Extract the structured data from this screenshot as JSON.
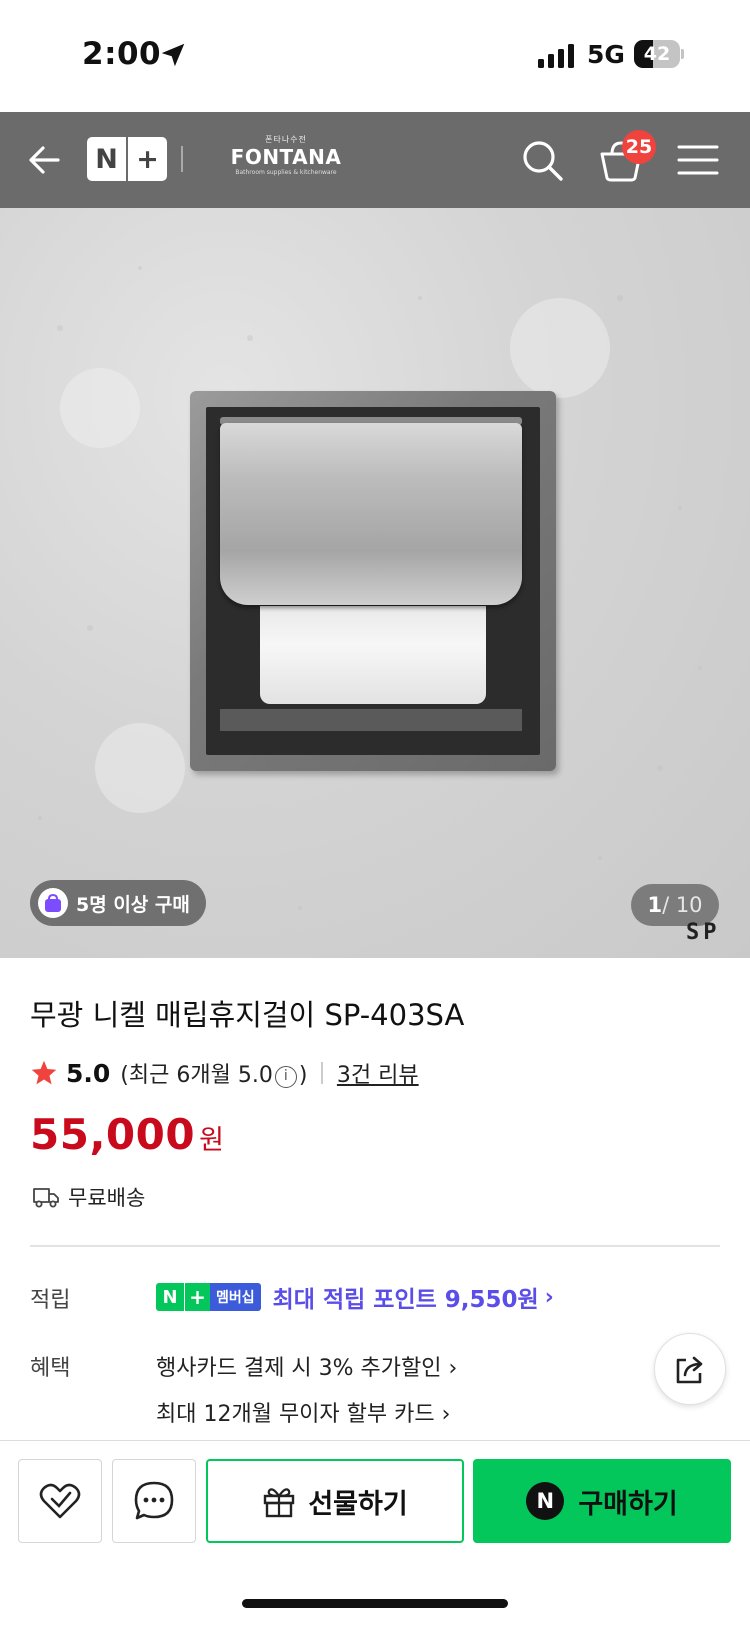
{
  "status_bar": {
    "time": "2:00",
    "network": "5G",
    "battery": "42",
    "battery_level": 0.42
  },
  "header": {
    "brand_small": "폰타나수전",
    "brand_name": "FONTANA",
    "brand_sub": "Bathroom supplies & kitchenware",
    "cart_count": "25",
    "icons": [
      "back-arrow-icon",
      "naver-plus-logo",
      "search-icon",
      "cart-icon",
      "menu-icon"
    ]
  },
  "product_image": {
    "badge": "5명 이상 구매",
    "page_current": "1",
    "page_total": "/ 10",
    "watermark": "SP"
  },
  "product": {
    "title": "무광 니켈 매립휴지걸이 SP-403SA",
    "rating": "5.0",
    "recent_rating_prefix": "(최근 6개월 5.0",
    "recent_rating_suffix": ")",
    "review_count": "3건 리뷰",
    "price": "55,000",
    "currency": "원",
    "shipping": "무료배송"
  },
  "points": {
    "label": "적립",
    "badge_n": "N",
    "badge_plus": "+",
    "badge_membership": "멤버십",
    "text": "최대 적립 포인트 9,550원",
    "chevron": "›"
  },
  "benefits": {
    "label": "혜택",
    "items": [
      "행사카드 결제 시 3% 추가할인 ›",
      "최대 12개월 무이자 할부 카드 ›"
    ]
  },
  "bottom_bar": {
    "gift_label": "선물하기",
    "buy_n": "N",
    "buy_label": "구매하기"
  },
  "colors": {
    "header_bg": "#6b6b6b",
    "price": "#c9091c",
    "naver_green": "#03c75a",
    "points_purple": "#5b4ee8",
    "badge_red": "#f0433e"
  }
}
